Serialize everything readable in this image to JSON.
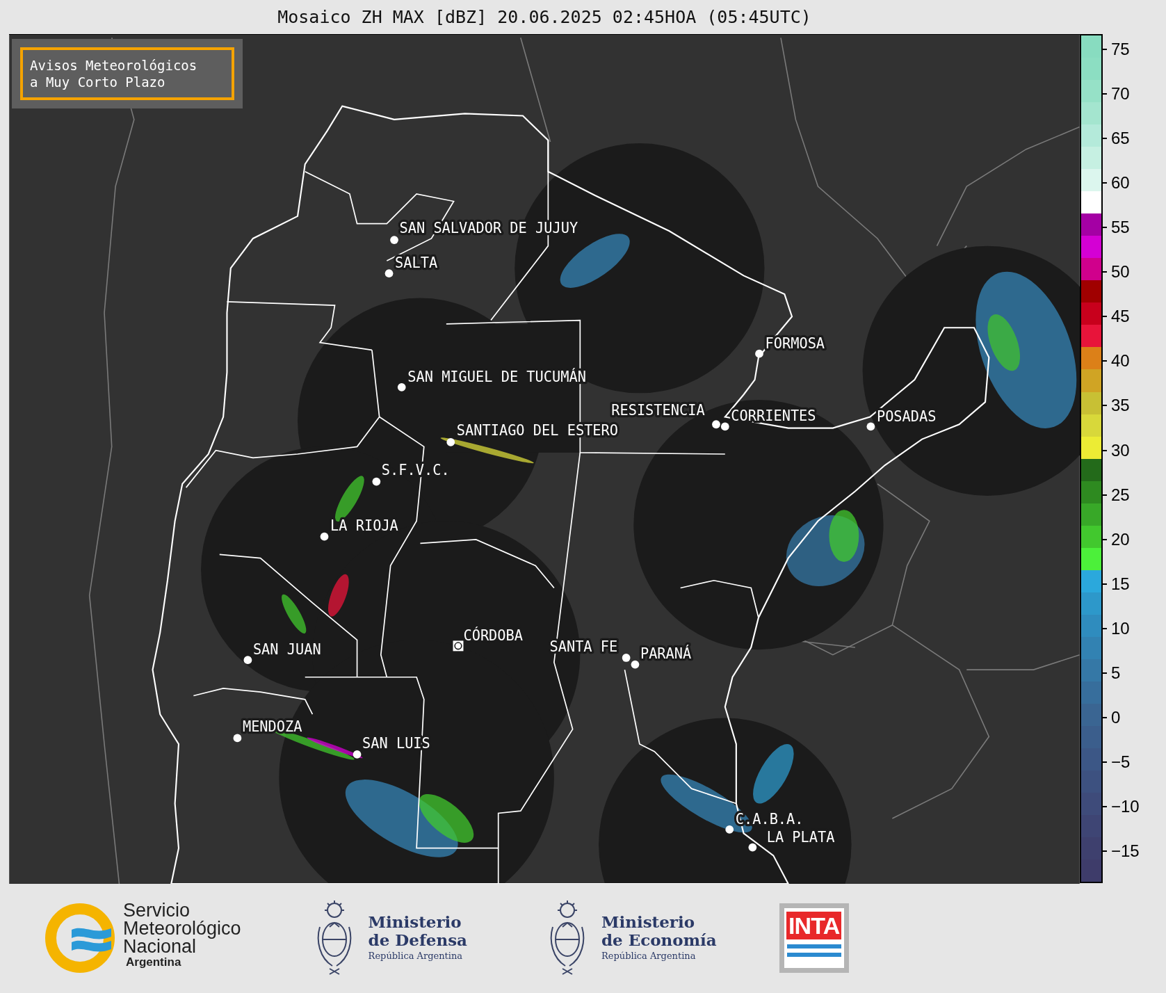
{
  "title": "Mosaico ZH MAX [dBZ] 20.06.2025 02:45HOA (05:45UTC)",
  "notice": [
    "Avisos Meteorológicos",
    "a Muy Corto Plazo"
  ],
  "cities": [
    {
      "name": "SAN SALVADOR DE JUJUY",
      "kind": "dot"
    },
    {
      "name": "SALTA",
      "kind": "dot"
    },
    {
      "name": "FORMOSA",
      "kind": "dot"
    },
    {
      "name": "SAN MIGUEL DE TUCUMÁN",
      "kind": "dot"
    },
    {
      "name": "RESISTENCIA",
      "kind": "dot"
    },
    {
      "name": "CORRIENTES",
      "kind": "dot"
    },
    {
      "name": "POSADAS",
      "kind": "dot"
    },
    {
      "name": "SANTIAGO DEL ESTERO",
      "kind": "dot"
    },
    {
      "name": "S.F.V.C.",
      "kind": "dot"
    },
    {
      "name": "LA RIOJA",
      "kind": "dot"
    },
    {
      "name": "CÓRDOBA",
      "kind": "square"
    },
    {
      "name": "SAN JUAN",
      "kind": "dot"
    },
    {
      "name": "SANTA FE",
      "kind": "dot"
    },
    {
      "name": "PARANÁ",
      "kind": "dot"
    },
    {
      "name": "MENDOZA",
      "kind": "dot"
    },
    {
      "name": "SAN LUIS",
      "kind": "dot"
    },
    {
      "name": "C.A.B.A.",
      "kind": "dot"
    },
    {
      "name": "LA PLATA",
      "kind": "dot"
    }
  ],
  "colorbar": {
    "ticks": [
      "75",
      "70",
      "65",
      "60",
      "55",
      "50",
      "45",
      "40",
      "35",
      "30",
      "25",
      "20",
      "15",
      "10",
      "5",
      "0",
      "−5",
      "−10",
      "−15"
    ],
    "segments": [
      {
        "color": "#88dcc0"
      },
      {
        "color": "#8cdec2"
      },
      {
        "color": "#96e1c7"
      },
      {
        "color": "#a4e5cf"
      },
      {
        "color": "#b4eada"
      },
      {
        "color": "#c6f0e2"
      },
      {
        "color": "#dcf6ee"
      },
      {
        "color": "#ffffff"
      },
      {
        "color": "#a400a4"
      },
      {
        "color": "#d400d4"
      },
      {
        "color": "#d0008c"
      },
      {
        "color": "#a00000"
      },
      {
        "color": "#c8001c"
      },
      {
        "color": "#e8143a"
      },
      {
        "color": "#dc8018"
      },
      {
        "color": "#d0a424"
      },
      {
        "color": "#c8c034"
      },
      {
        "color": "#d8d83a"
      },
      {
        "color": "#ecec34"
      },
      {
        "color": "#236a1a"
      },
      {
        "color": "#2e8a20"
      },
      {
        "color": "#38a828"
      },
      {
        "color": "#42c82e"
      },
      {
        "color": "#4cf03a"
      },
      {
        "color": "#2ba8dc"
      },
      {
        "color": "#2d98ca"
      },
      {
        "color": "#2f8cbe"
      },
      {
        "color": "#3282b2"
      },
      {
        "color": "#3578a6"
      },
      {
        "color": "#376e9c"
      },
      {
        "color": "#3a6592"
      },
      {
        "color": "#3b5e8c"
      },
      {
        "color": "#3c5786"
      },
      {
        "color": "#3d5180"
      },
      {
        "color": "#3e4b7a"
      },
      {
        "color": "#3e4574"
      },
      {
        "color": "#3e406e"
      },
      {
        "color": "#3e3c6a"
      }
    ]
  },
  "footer": [
    {
      "kind": "smn",
      "lines": [
        "Servicio",
        "Meteorológico",
        "Nacional"
      ],
      "subtitle": "Argentina"
    },
    {
      "kind": "ministry",
      "lines": [
        "Ministerio",
        "de Defensa"
      ],
      "subtitle": "República Argentina"
    },
    {
      "kind": "ministry",
      "lines": [
        "Ministerio",
        "de Economía"
      ],
      "subtitle": "República Argentina"
    },
    {
      "kind": "inta",
      "lines": [
        "INTA"
      ]
    }
  ]
}
